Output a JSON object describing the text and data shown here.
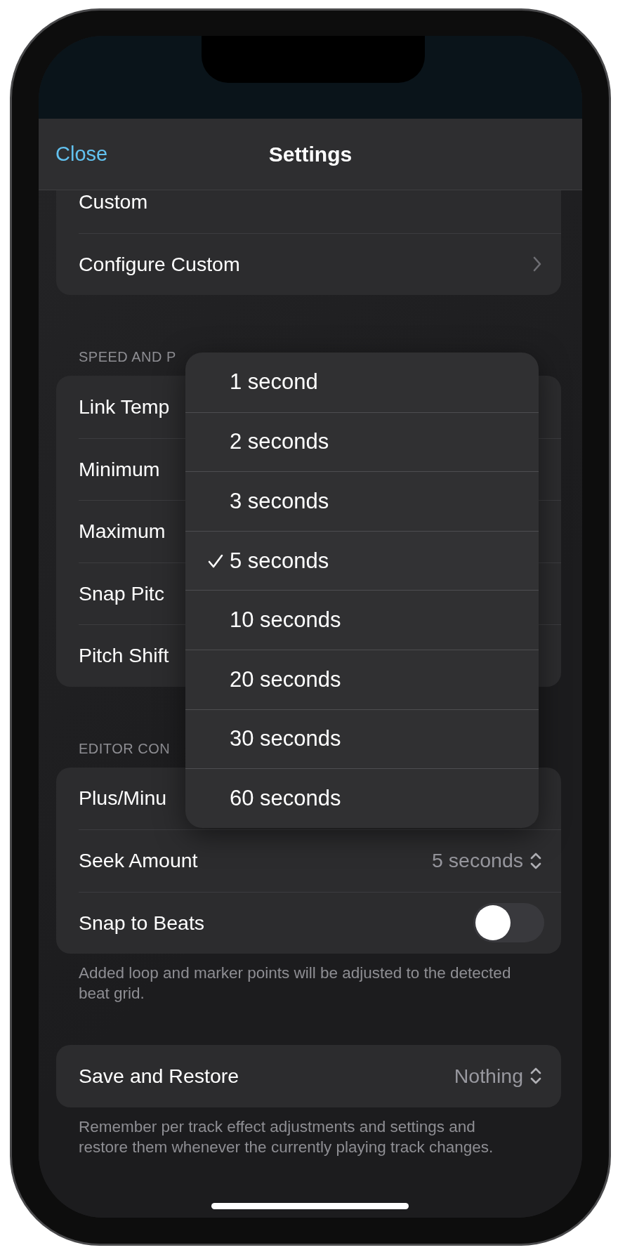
{
  "nav": {
    "close": "Close",
    "title": "Settings"
  },
  "sections": [
    {
      "rows": [
        {
          "kind": "plain",
          "label": "Custom"
        },
        {
          "kind": "link",
          "label": "Configure Custom"
        }
      ]
    },
    {
      "header": "SPEED AND P",
      "rows": [
        {
          "kind": "plain",
          "label": "Link Temp"
        },
        {
          "kind": "plain",
          "label": "Minimum"
        },
        {
          "kind": "plain",
          "label": "Maximum"
        },
        {
          "kind": "plain",
          "label": "Snap Pitc"
        },
        {
          "kind": "plain",
          "label": "Pitch Shift"
        }
      ]
    },
    {
      "header": "EDITOR CON",
      "rows": [
        {
          "kind": "plain",
          "label": "Plus/Minu"
        },
        {
          "kind": "picker",
          "label": "Seek Amount",
          "value": "5 seconds"
        },
        {
          "kind": "toggle",
          "label": "Snap to Beats",
          "on": false
        }
      ],
      "footer": "Added loop and marker points will be adjusted to the detected beat grid."
    },
    {
      "rows": [
        {
          "kind": "picker",
          "label": "Save and Restore",
          "value": "Nothing"
        }
      ],
      "footer": "Remember per track effect adjustments and settings and restore them whenever the currently playing track changes."
    }
  ],
  "menu": {
    "options": [
      {
        "label": "1 second",
        "selected": false
      },
      {
        "label": "2 seconds",
        "selected": false
      },
      {
        "label": "3 seconds",
        "selected": false
      },
      {
        "label": "5 seconds",
        "selected": true
      },
      {
        "label": "10 seconds",
        "selected": false
      },
      {
        "label": "20 seconds",
        "selected": false
      },
      {
        "label": "30 seconds",
        "selected": false
      },
      {
        "label": "60 seconds",
        "selected": false
      }
    ]
  }
}
